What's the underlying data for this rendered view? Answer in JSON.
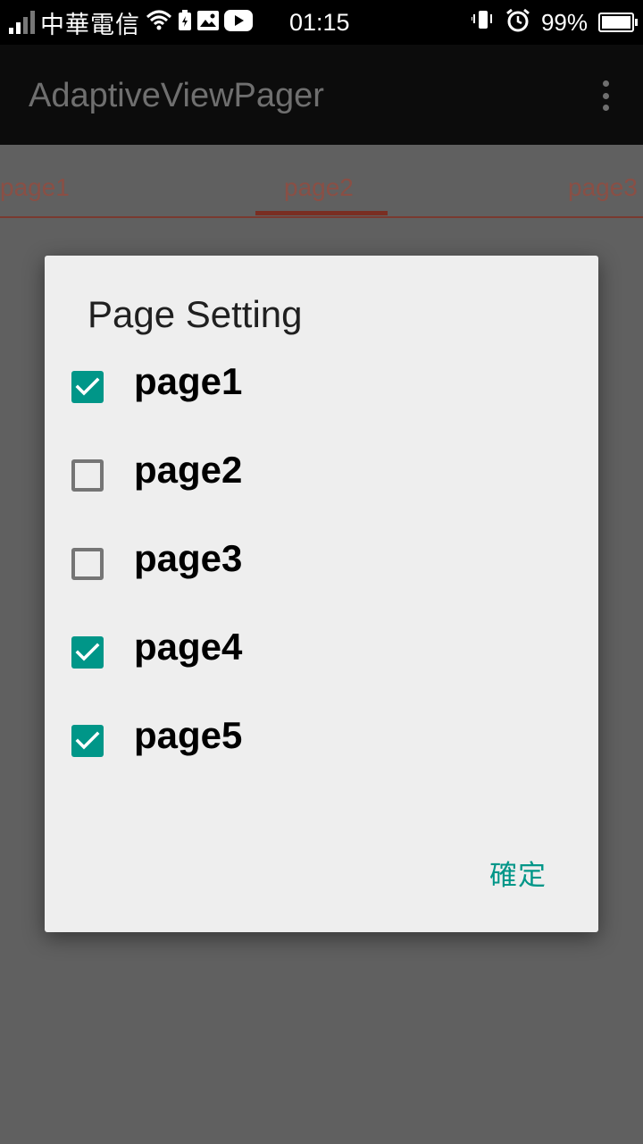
{
  "status_bar": {
    "carrier": "中華電信",
    "time": "01:15",
    "battery_percent": "99%",
    "battery_level": 0.99,
    "icons": [
      "signal-icon",
      "wifi-icon",
      "battery-saver-icon",
      "image-icon",
      "youtube-icon",
      "vibrate-icon",
      "alarm-icon",
      "battery-icon"
    ]
  },
  "app_bar": {
    "title": "AdaptiveViewPager",
    "menu_icon": "more-vert-icon"
  },
  "tabs": [
    {
      "label": "page1"
    },
    {
      "label": "page2",
      "selected": true
    },
    {
      "label": "page3"
    }
  ],
  "dialog": {
    "title": "Page Setting",
    "options": [
      {
        "label": "page1",
        "checked": true
      },
      {
        "label": "page2",
        "checked": false
      },
      {
        "label": "page3",
        "checked": false
      },
      {
        "label": "page4",
        "checked": true
      },
      {
        "label": "page5",
        "checked": true
      }
    ],
    "confirm_label": "確定"
  },
  "colors": {
    "accent": "#009688",
    "tab_indicator": "#7a2e22",
    "scrim": "#606060",
    "dialog_bg": "#eeeeee"
  }
}
